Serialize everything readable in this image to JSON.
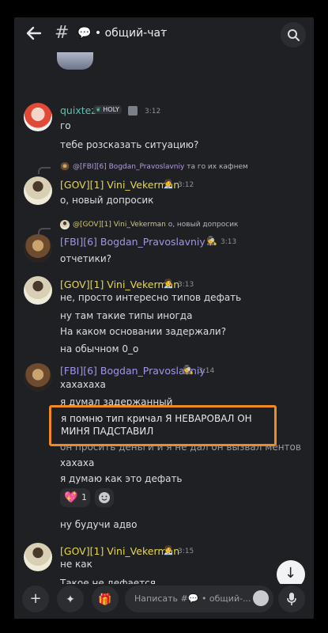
{
  "header": {
    "channel": "💬 • общий-чат"
  },
  "messages": [
    {
      "author": "quixtez",
      "badge": "HOLY",
      "time": "3:12",
      "lines": [
        "го",
        "тебе розсказать ситуацию?"
      ]
    },
    {
      "reply_to": "@[FBI][6] Bogdan_Pravoslavniy",
      "reply_text": "та го их кафнем",
      "author": "[GOV][1] Vini_Vekerman",
      "time": "3:12",
      "lines": [
        "о, новый допросик"
      ]
    },
    {
      "reply_to": "@[GOV][1] Vini_Vekerman",
      "reply_text": "о, новый допросик",
      "author": "[FBI][6] Bogdan_Pravoslavniy",
      "time": "3:13",
      "lines": [
        "отчетики?"
      ]
    },
    {
      "author": "[GOV][1] Vini_Vekerman",
      "time": "3:13",
      "lines": [
        "не, просто интересно типов дефать",
        "ну там такие типы иногда",
        "На каком основании задержали?",
        "на обычном 0_о"
      ]
    },
    {
      "author": "[FBI][6] Bogdan_Pravoslavniy",
      "time": "3:14",
      "lines": [
        "хахахаха",
        "я думал задержанный",
        "он просить деньги и я не дал он вызвал ментов",
        "хахаха",
        "я думаю как это дефать",
        "ну будучи адво"
      ]
    },
    {
      "author": "[GOV][1] Vini_Vekerman",
      "time": "3:15",
      "lines": [
        "не как",
        "Такое не дефается"
      ]
    }
  ],
  "highlight_text": "я помню тип кричал Я НЕВАРОВАЛ ОН МИНЯ ПАДСТАВИЛ",
  "reactions": [
    {
      "icon": "heart-sparkle-icon",
      "count": "1"
    },
    {
      "icon": "add-reaction-icon"
    }
  ],
  "composer": {
    "placeholder": "Написать #💬 • общий-..."
  },
  "colors": {
    "gov": "#e7d84a",
    "fbi": "#9f97e8",
    "quix": "#4cc9b0",
    "highlight_border": "#f08a24"
  }
}
